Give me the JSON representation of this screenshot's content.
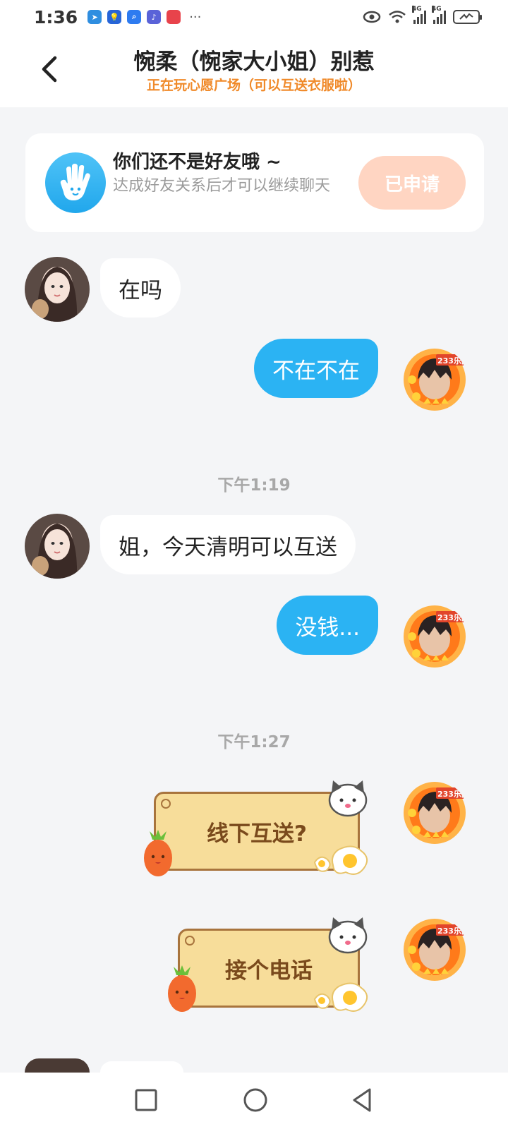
{
  "status_bar": {
    "time": "1:36",
    "more": "···",
    "network_1": "4G",
    "network_2": "4G"
  },
  "header": {
    "title": "惋柔（惋家大小姐）别惹",
    "subtitle": "正在玩心愿广场（可以互送衣服啦）"
  },
  "friend_card": {
    "title": "你们还不是好友哦 ~",
    "description": "达成好友关系后才可以继续聊天",
    "button_label": "已申请"
  },
  "messages": [
    {
      "type": "text",
      "side": "left",
      "text": "在吗"
    },
    {
      "type": "text",
      "side": "right",
      "text": "不在不在"
    },
    {
      "type": "time",
      "text": "下午1:19"
    },
    {
      "type": "text",
      "side": "left",
      "text": "姐，今天清明可以互送"
    },
    {
      "type": "text",
      "side": "right",
      "text": "没钱..."
    },
    {
      "type": "time",
      "text": "下午1:27"
    },
    {
      "type": "sticker",
      "side": "right",
      "text": "线下互送?"
    },
    {
      "type": "sticker",
      "side": "right",
      "text": "接个电话"
    }
  ],
  "colors": {
    "accent_blue": "#2bb3f3",
    "subtitle_orange": "#f08a2a",
    "applied_button": "#ffd5c2",
    "sticker_board": "#f7dd9a"
  },
  "icons": [
    "back-icon",
    "hand-wave-icon",
    "square-nav-icon",
    "circle-nav-icon",
    "triangle-back-nav-icon"
  ]
}
